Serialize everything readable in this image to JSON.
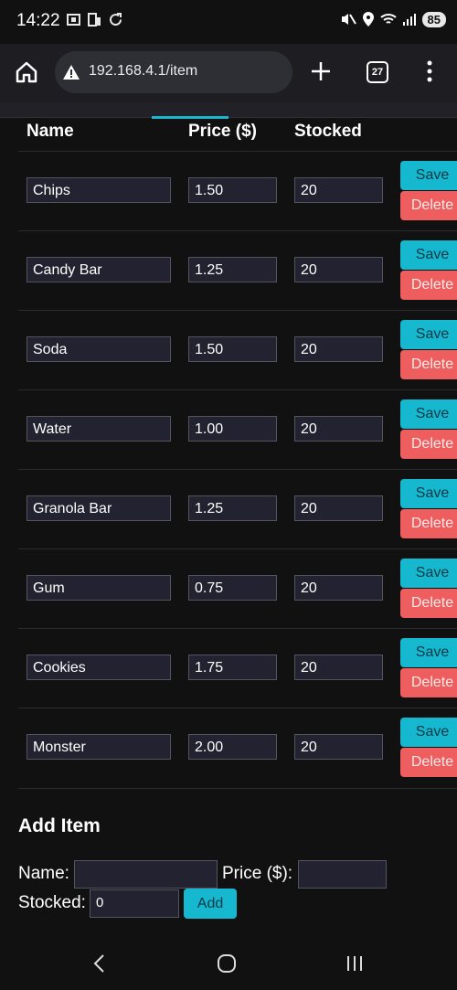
{
  "status": {
    "time": "14:22",
    "battery": "85"
  },
  "browser": {
    "url": "192.168.4.1/item",
    "tab_count": "27"
  },
  "table": {
    "headers": {
      "name": "Name",
      "price": "Price ($)",
      "stocked": "Stocked"
    },
    "save_label": "Save",
    "delete_label": "Delete",
    "rows": [
      {
        "name": "Chips",
        "price": "1.50",
        "stocked": "20"
      },
      {
        "name": "Candy Bar",
        "price": "1.25",
        "stocked": "20"
      },
      {
        "name": "Soda",
        "price": "1.50",
        "stocked": "20"
      },
      {
        "name": "Water",
        "price": "1.00",
        "stocked": "20"
      },
      {
        "name": "Granola Bar",
        "price": "1.25",
        "stocked": "20"
      },
      {
        "name": "Gum",
        "price": "0.75",
        "stocked": "20"
      },
      {
        "name": "Cookies",
        "price": "1.75",
        "stocked": "20"
      },
      {
        "name": "Monster",
        "price": "2.00",
        "stocked": "20"
      }
    ]
  },
  "add_item": {
    "title": "Add Item",
    "name_label": "Name:",
    "price_label": "Price ($):",
    "stocked_label": "Stocked:",
    "name_value": "",
    "price_value": "",
    "stocked_value": "0",
    "add_button": "Add"
  },
  "colors": {
    "accent": "#15b8cf",
    "danger": "#ef5e5e",
    "background": "#111111"
  }
}
